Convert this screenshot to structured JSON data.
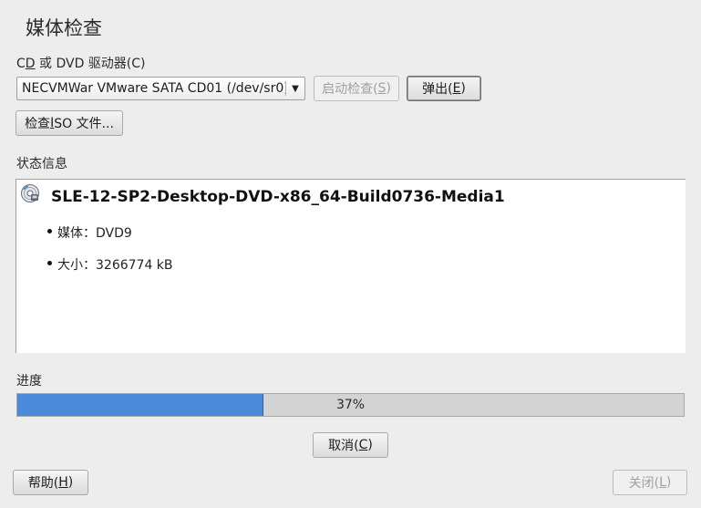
{
  "dialog": {
    "title": "媒体检查"
  },
  "drive": {
    "label_pre": "C",
    "label_ul": "D",
    "label_post": " 或 DVD 驱动器(C)",
    "selected": "NECVMWar VMware SATA CD01 (/dev/sr0)"
  },
  "buttons": {
    "start_check_pre": "启动检查(",
    "start_check_ul": "S",
    "start_check_post": ")",
    "eject_pre": "弹出(",
    "eject_ul": "E",
    "eject_post": ")",
    "check_iso_pre": "检查 ",
    "check_iso_ul": "I",
    "check_iso_post": "SO 文件...",
    "cancel_pre": "取消(",
    "cancel_ul": "C",
    "cancel_post": ")",
    "help_pre": "帮助(",
    "help_ul": "H",
    "help_post": ")",
    "close_pre": "关闭(",
    "close_ul": "L",
    "close_post": ")"
  },
  "status": {
    "label": "状态信息",
    "icon": "disc-icon",
    "heading": "SLE-12-SP2-Desktop-DVD-x86_64-Build0736-Media1",
    "items": [
      "媒体：DVD9",
      "大小：3266774 kB"
    ]
  },
  "progress": {
    "label": "进度",
    "value": 0.37,
    "text": "37%",
    "fill_color": "#4a8ad8"
  }
}
